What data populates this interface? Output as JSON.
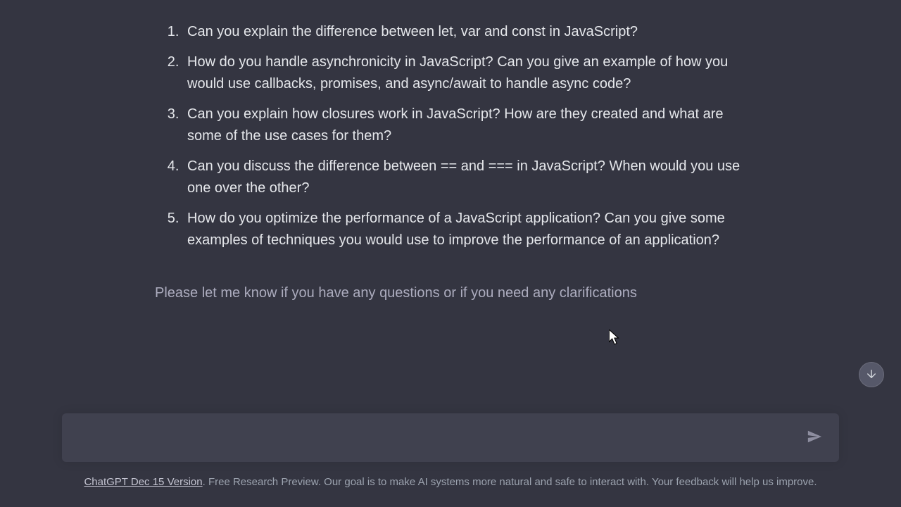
{
  "message": {
    "list_items": [
      "Can you explain the difference between let, var and const in JavaScript?",
      "How do you handle asynchronicity in JavaScript? Can you give an example of how you would use callbacks, promises, and async/await to handle async code?",
      "Can you explain how closures work in JavaScript? How are they created and what are some of the use cases for them?",
      "Can you discuss the difference between == and === in JavaScript? When would you use one over the other?",
      "How do you optimize the performance of a JavaScript application? Can you give some examples of techniques you would use to improve the performance of an application?"
    ],
    "closing": "Please let me know if you have any questions or if you need any clarifications"
  },
  "input": {
    "placeholder": ""
  },
  "footer": {
    "link_text": "ChatGPT Dec 15 Version",
    "rest_text": ". Free Research Preview. Our goal is to make AI systems more natural and safe to interact with. Your feedback will help us improve."
  }
}
